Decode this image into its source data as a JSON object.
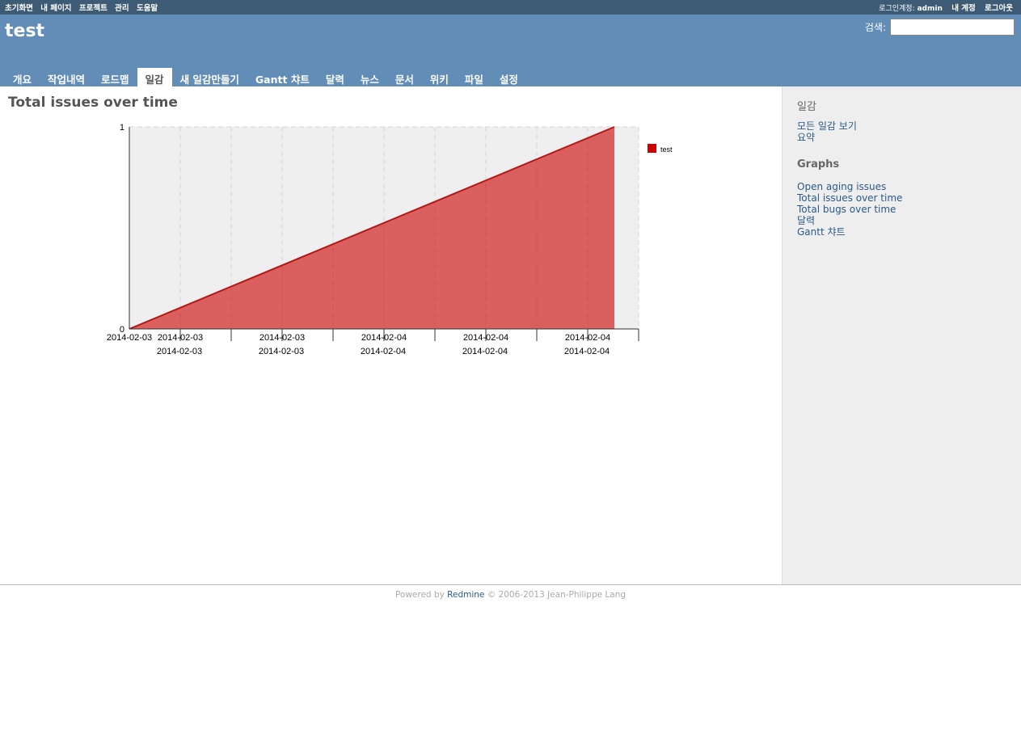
{
  "top_menu": {
    "items": [
      "초기화면",
      "내 페이지",
      "프로젝트",
      "관리",
      "도움말"
    ],
    "logged_as_label": "로그인계정:",
    "user": "admin",
    "my_account": "내 계정",
    "logout": "로그아웃"
  },
  "header": {
    "project_title": "test",
    "search_label": "검색:",
    "search_value": ""
  },
  "main_menu": {
    "tabs": [
      "개요",
      "작업내역",
      "로드맵",
      "일감",
      "새 일감만들기",
      "Gantt 챠트",
      "달력",
      "뉴스",
      "문서",
      "위키",
      "파일",
      "설정"
    ],
    "selected": "일감"
  },
  "content": {
    "title": "Total issues over time"
  },
  "chart_data": {
    "type": "area",
    "title": "",
    "xlabel": "",
    "ylabel": "",
    "ylim": [
      0,
      1
    ],
    "y_ticks": [
      "0",
      "1"
    ],
    "x_ticks_row1": [
      "2014-02-03",
      "2014-02-03",
      "2014-02-04",
      "2014-02-04",
      "2014-02-04"
    ],
    "x_ticks_row2": [
      "2014-02-03",
      "2014-02-03",
      "2014-02-04",
      "2014-02-04",
      "2014-02-04"
    ],
    "x_tick_values": [
      0,
      0.105,
      0.21,
      0.315,
      0.42,
      0.525,
      0.63,
      0.735,
      0.84,
      0.945,
      1.05
    ],
    "x_range": [
      0,
      1.05
    ],
    "series": [
      {
        "name": "test",
        "color": "#CC0000",
        "points": [
          [
            0,
            0
          ],
          [
            1,
            1
          ]
        ]
      }
    ],
    "legend_position": "right",
    "grid": true
  },
  "sidebar": {
    "issues_title": "일감",
    "issues_links": [
      "모든 일감 보기",
      "요약"
    ],
    "graphs_title": "Graphs",
    "graphs_links": [
      "Open aging issues",
      "Total issues over time",
      "Total bugs over time",
      "달력",
      "Gantt 챠트"
    ]
  },
  "footer": {
    "powered_by": "Powered by",
    "redmine": "Redmine",
    "copyright": "© 2006-2013 Jean-Philippe Lang"
  }
}
